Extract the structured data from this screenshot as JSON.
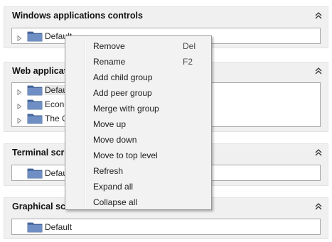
{
  "sections": [
    {
      "title": "Windows applications controls",
      "nodes": [
        {
          "label": "Default",
          "expandable": true
        }
      ]
    },
    {
      "title": "Web applicat",
      "nodes": [
        {
          "label": "Defau",
          "expandable": true
        },
        {
          "label": "Econo",
          "expandable": true
        },
        {
          "label": "The G",
          "expandable": true
        }
      ]
    },
    {
      "title": "Terminal scre",
      "nodes": [
        {
          "label": "Defau",
          "expandable": false
        }
      ]
    },
    {
      "title": "Graphical scr",
      "nodes": [
        {
          "label": "Default",
          "expandable": false
        }
      ]
    }
  ],
  "icons": {
    "collapse": "double-chevron-up-icon",
    "expander": "expand-triangle-icon",
    "folder": "folder-icon"
  },
  "context_menu": {
    "items": [
      {
        "label": "Remove",
        "shortcut": "Del"
      },
      {
        "label": "Rename",
        "shortcut": "F2"
      },
      {
        "label": "Add child group",
        "shortcut": ""
      },
      {
        "label": "Add peer group",
        "shortcut": ""
      },
      {
        "label": "Merge with group",
        "shortcut": ""
      },
      {
        "label": "Move up",
        "shortcut": ""
      },
      {
        "label": "Move down",
        "shortcut": ""
      },
      {
        "label": "Move to top level",
        "shortcut": ""
      },
      {
        "label": "Refresh",
        "shortcut": ""
      },
      {
        "label": "Expand all",
        "shortcut": ""
      },
      {
        "label": "Collapse all",
        "shortcut": ""
      }
    ]
  },
  "colors": {
    "folder": "#4a6fa8",
    "panel": "#f0f0f0",
    "menu": "#f2f2f2"
  }
}
